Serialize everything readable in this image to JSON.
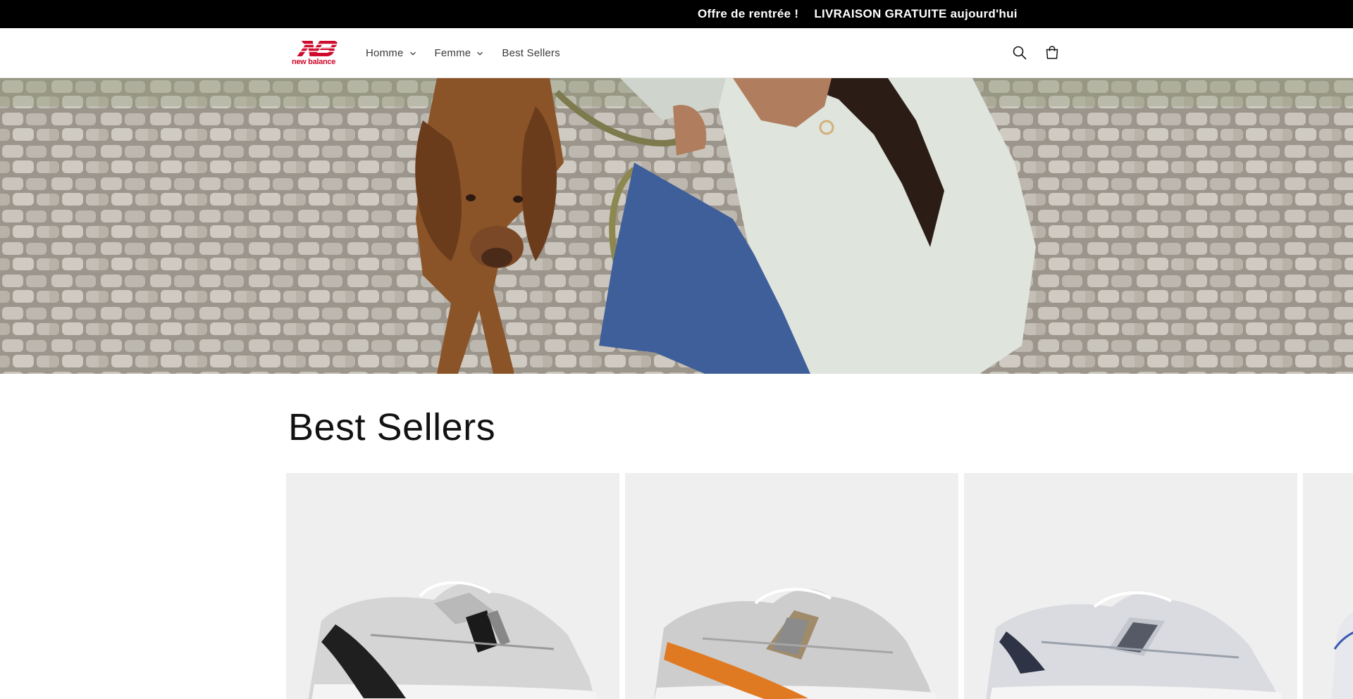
{
  "announcement": {
    "message_1": "Offre de rentrée !",
    "message_2": "LIVRAISON GRATUITE aujourd'hui"
  },
  "header": {
    "logo_text": "new balance",
    "nav": [
      {
        "label": "Homme",
        "has_dropdown": true
      },
      {
        "label": "Femme",
        "has_dropdown": true
      },
      {
        "label": "Best Sellers",
        "has_dropdown": false
      }
    ],
    "icons": [
      "search-icon",
      "cart-icon"
    ]
  },
  "hero": {
    "image": "dog-and-woman-on-cobblestone-photo"
  },
  "best_sellers": {
    "title": "Best Sellers",
    "products": [
      {
        "image": "silver-black-sneaker"
      },
      {
        "image": "silver-orange-sneaker"
      },
      {
        "image": "silver-navy-sneaker"
      },
      {
        "image": "white-blue-sneaker-partial"
      }
    ]
  },
  "colors": {
    "announcement_bg": "#000000",
    "brand_red": "#cf0a2c",
    "card_bg": "#efefef"
  }
}
